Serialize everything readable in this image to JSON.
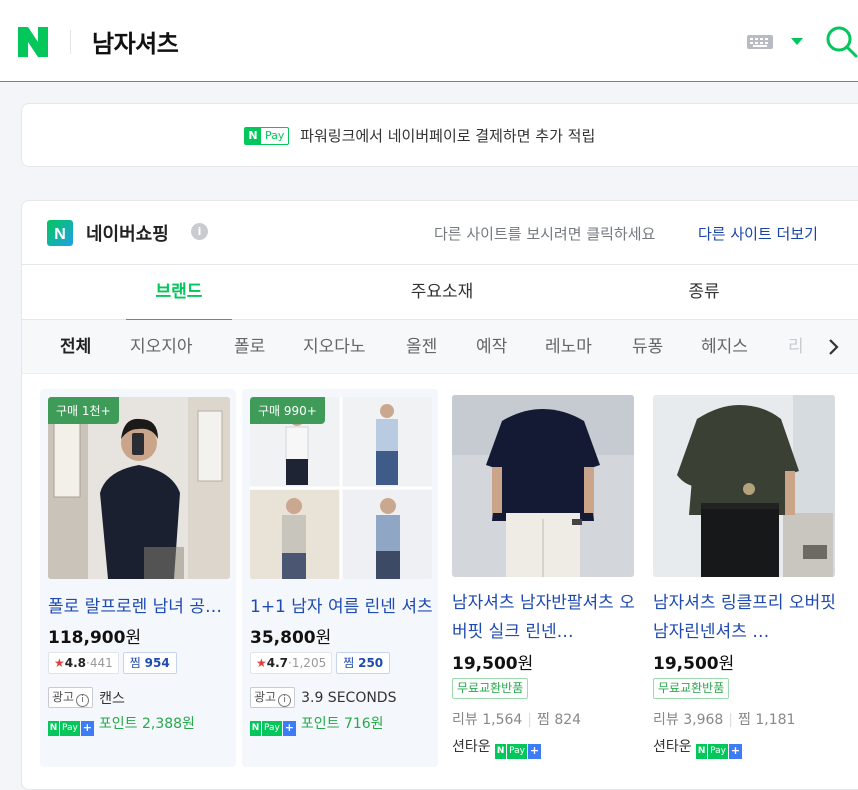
{
  "header": {
    "logo_letter": "N",
    "query": "남자셔츠",
    "brand_color": "#03c75a"
  },
  "paybox": {
    "npay_n": "N",
    "npay_label": "Pay",
    "text": "파워링크에서 네이버페이로 결제하면 추가 적립"
  },
  "shopping": {
    "logo_letter": "N",
    "title": "네이버쇼핑",
    "info_icon": "i",
    "hint": "다른 사이트를 보시려면 클릭하세요",
    "more_link": "다른 사이트 더보기",
    "tabs": [
      {
        "label": "브랜드",
        "active": true
      },
      {
        "label": "주요소재",
        "active": false
      },
      {
        "label": "종류",
        "active": false
      }
    ],
    "chips": [
      {
        "label": "전체"
      },
      {
        "label": "지오지아"
      },
      {
        "label": "폴로"
      },
      {
        "label": "지오다노"
      },
      {
        "label": "올젠"
      },
      {
        "label": "예작"
      },
      {
        "label": "레노마"
      },
      {
        "label": "듀퐁"
      },
      {
        "label": "헤지스"
      },
      {
        "label": "리"
      }
    ],
    "products": [
      {
        "badge": "구매 1천+",
        "name": "폴로 랄프로렌 남녀 공용 셔츠",
        "price": "118,900",
        "currency": "원",
        "rating_star": "★",
        "rating": "4.8",
        "rating_sep": "·",
        "review_count": "441",
        "zzim_label": "찜",
        "zzim_count": "954",
        "ad_label": "광고",
        "ad_icon": "i",
        "seller": "캔스",
        "npay_n": "N",
        "npay_label": "Pay",
        "npay_plus": "+",
        "point": "포인트 2,388원"
      },
      {
        "badge": "구매 990+",
        "name": "1+1 남자 여름 린넨 셔츠",
        "price": "35,800",
        "currency": "원",
        "rating_star": "★",
        "rating": "4.7",
        "rating_sep": "·",
        "review_count": "1,205",
        "zzim_label": "찜",
        "zzim_count": "250",
        "ad_label": "광고",
        "ad_icon": "i",
        "seller": "3.9 SECONDS",
        "npay_n": "N",
        "npay_label": "Pay",
        "npay_plus": "+",
        "point": "포인트 716원"
      },
      {
        "name": "남자셔츠 남자반팔셔츠 오버핏 실크 린넨…",
        "price": "19,500",
        "currency": "원",
        "free_tag": "무료교환반품",
        "review_label": "리뷰 1,564",
        "zzim_label": "찜 824",
        "seller": "션타운",
        "npay_n": "N",
        "npay_label": "Pay",
        "npay_plus": "+"
      },
      {
        "name": "남자셔츠 링클프리 오버핏 남자린넨셔츠 …",
        "price": "19,500",
        "currency": "원",
        "free_tag": "무료교환반품",
        "review_label": "리뷰 3,968",
        "zzim_label": "찜 1,181",
        "seller": "션타운",
        "npay_n": "N",
        "npay_label": "Pay",
        "npay_plus": "+"
      }
    ]
  }
}
